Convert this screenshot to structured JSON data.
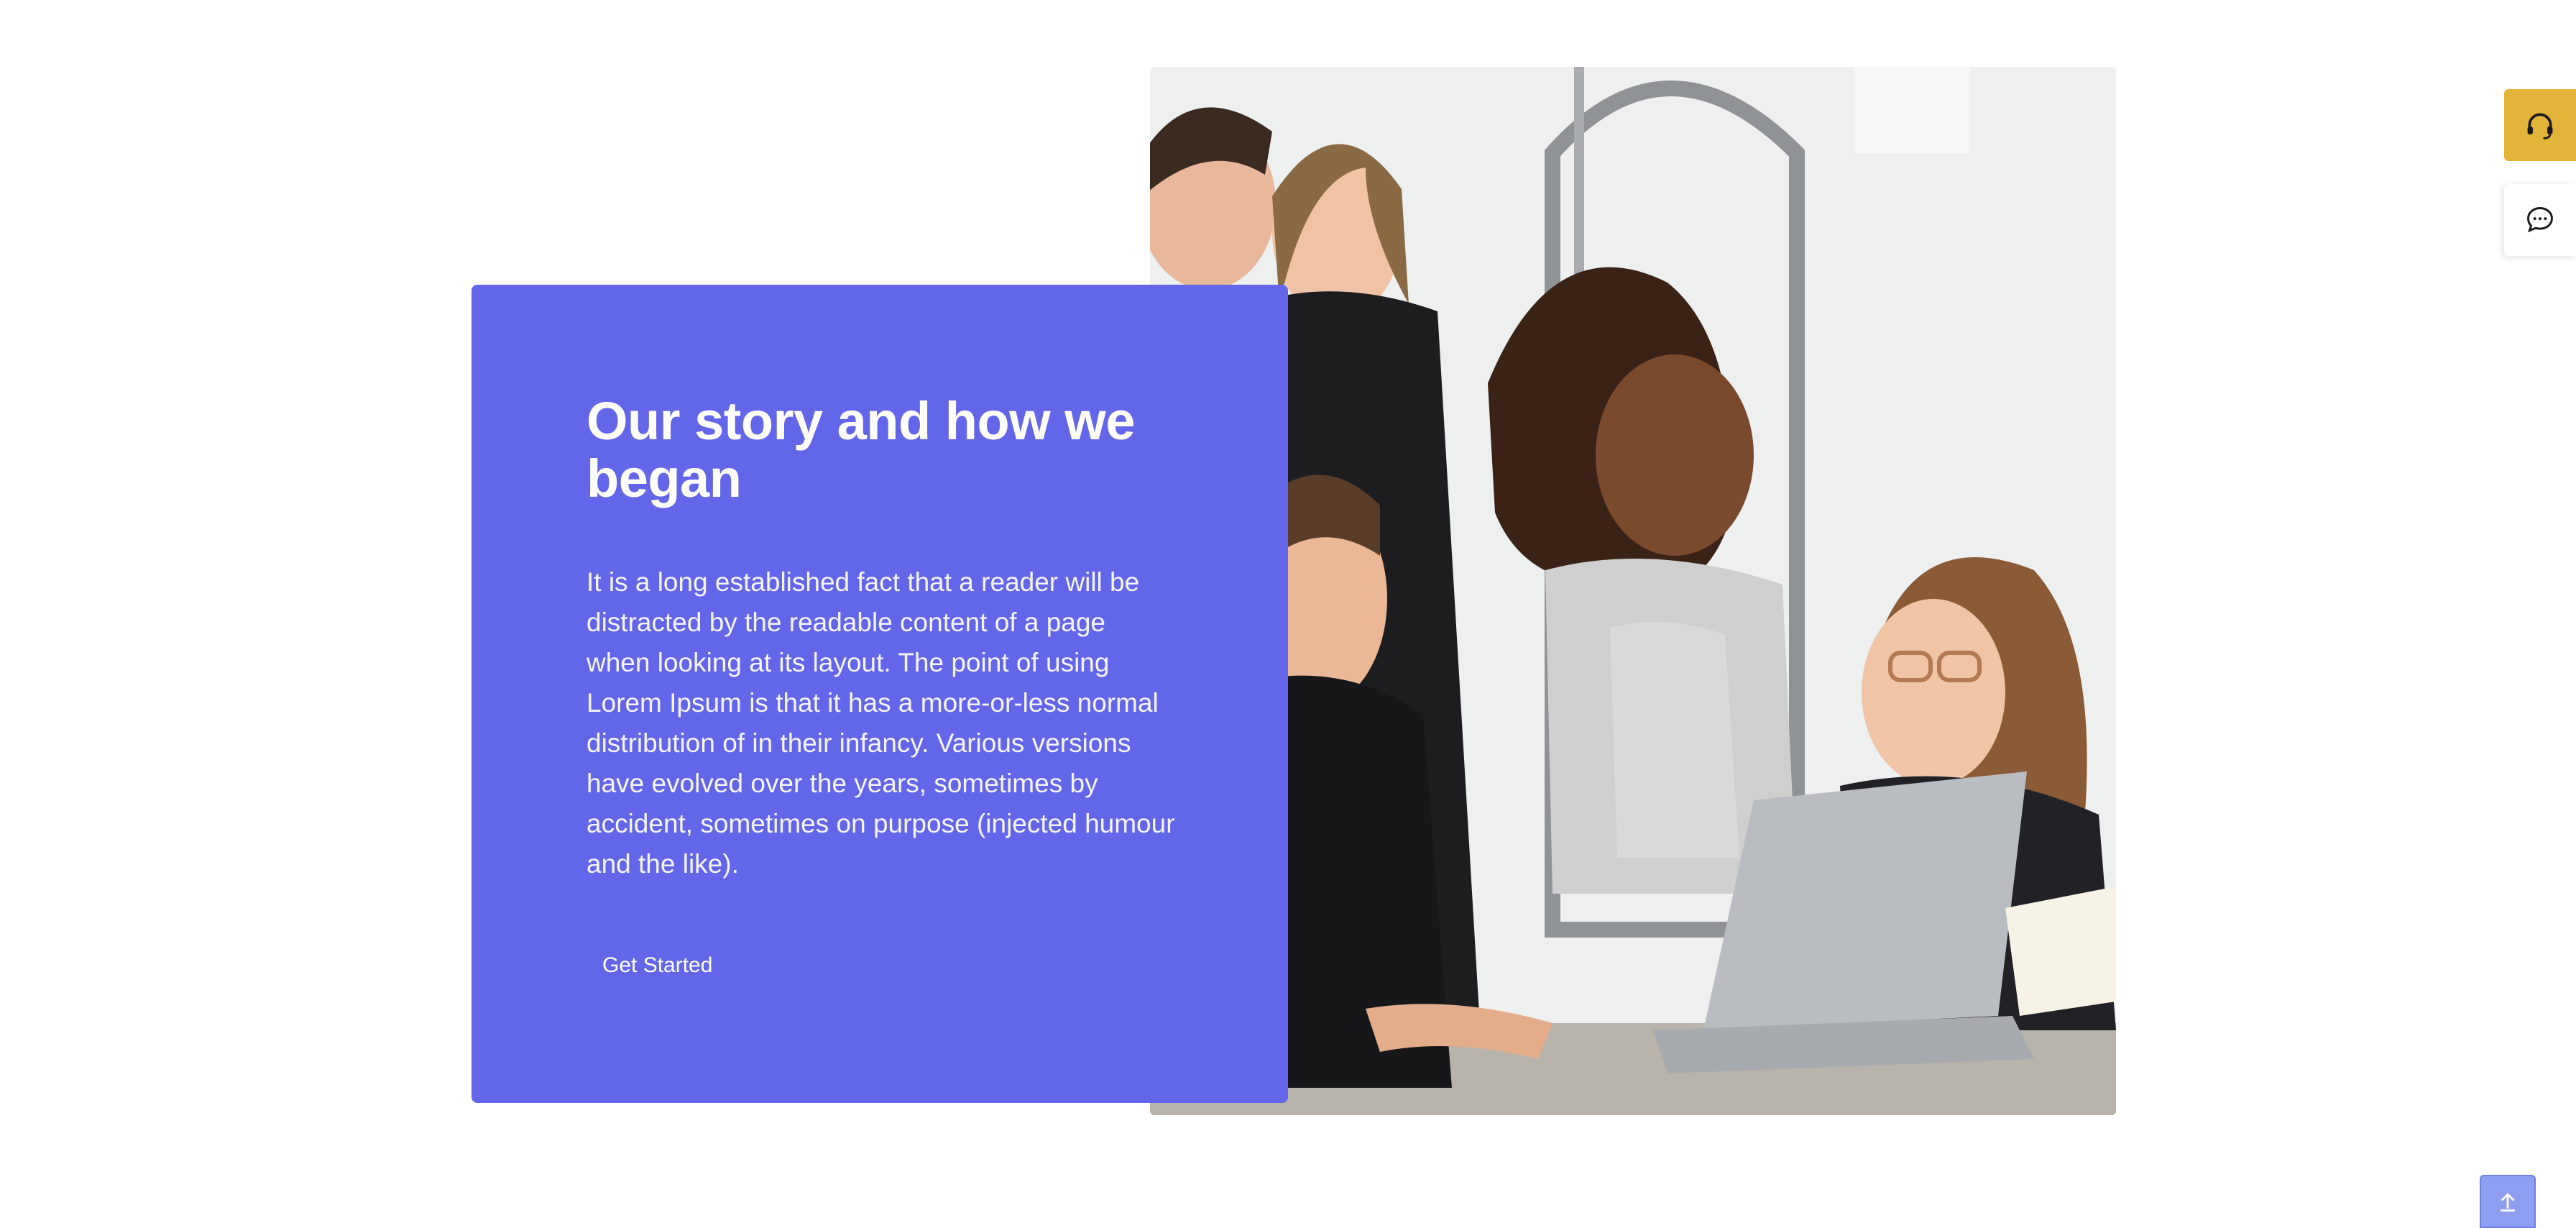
{
  "story": {
    "title": "Our story and how we began",
    "body": "It is a long established fact that a reader will be distracted by the readable content of a page when looking at its layout. The point of using Lorem Ipsum is that it has a more-or-less normal distribution of in their infancy. Various versions have evolved over the years, sometimes by accident, sometimes on purpose (injected humour and the like).",
    "cta_label": "Get Started"
  },
  "photo": {
    "subject": "team-collaborating-at-laptop"
  },
  "widgets": {
    "support_icon": "headset-icon",
    "chat_icon": "chat-bubble-icon",
    "scroll_top_icon": "arrow-up-icon"
  },
  "colors": {
    "card_bg": "#6366e8",
    "support_bg": "#e3b43a",
    "scroll_top_bg": "#8e9ef0",
    "text_on_card": "#ffffff"
  }
}
